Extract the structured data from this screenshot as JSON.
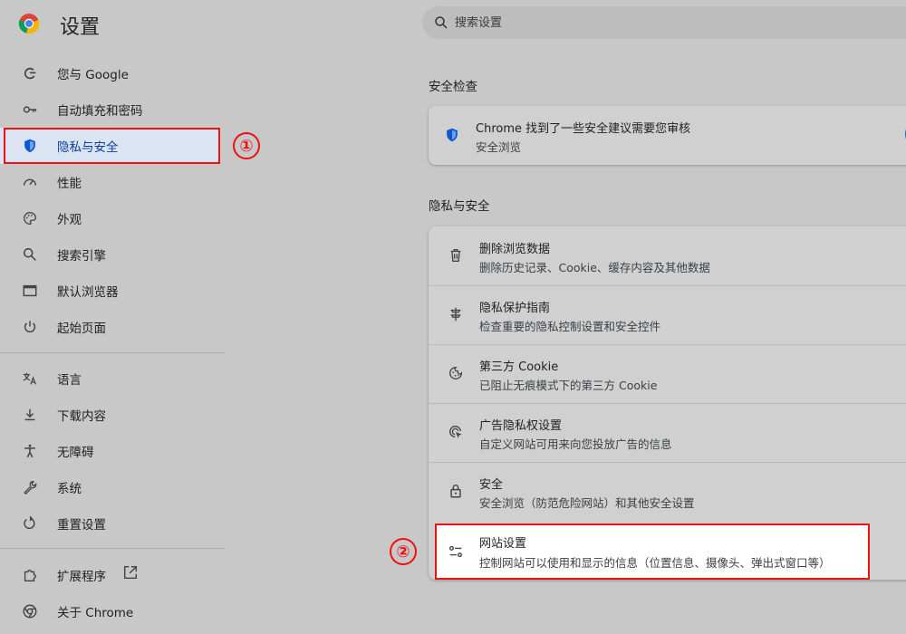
{
  "header": {
    "title": "设置",
    "search_placeholder": "搜索设置"
  },
  "sidebar": {
    "items": [
      {
        "label": "您与 Google",
        "icon": "google-g-icon"
      },
      {
        "label": "自动填充和密码",
        "icon": "key-icon"
      },
      {
        "label": "隐私与安全",
        "icon": "shield-icon",
        "active": true
      },
      {
        "label": "性能",
        "icon": "speedometer-icon"
      },
      {
        "label": "外观",
        "icon": "palette-icon"
      },
      {
        "label": "搜索引擎",
        "icon": "search-icon"
      },
      {
        "label": "默认浏览器",
        "icon": "browser-window-icon"
      },
      {
        "label": "起始页面",
        "icon": "power-icon"
      },
      {
        "label": "语言",
        "icon": "translate-icon"
      },
      {
        "label": "下载内容",
        "icon": "download-icon"
      },
      {
        "label": "无障碍",
        "icon": "accessibility-icon"
      },
      {
        "label": "系统",
        "icon": "wrench-icon"
      },
      {
        "label": "重置设置",
        "icon": "reset-icon"
      },
      {
        "label": "扩展程序",
        "icon": "puzzle-icon"
      },
      {
        "label": "关于 Chrome",
        "icon": "chrome-icon"
      }
    ]
  },
  "safety_check": {
    "section_title": "安全检查",
    "title": "Chrome 找到了一些安全建议需要您审核",
    "subtitle": "安全浏览"
  },
  "privacy": {
    "section_title": "隐私与安全",
    "rows": [
      {
        "title": "删除浏览数据",
        "subtitle": "删除历史记录、Cookie、缓存内容及其他数据",
        "icon": "trash-icon"
      },
      {
        "title": "隐私保护指南",
        "subtitle": "检查重要的隐私控制设置和安全控件",
        "icon": "privacy-guide-icon"
      },
      {
        "title": "第三方 Cookie",
        "subtitle": "已阻止无痕模式下的第三方 Cookie",
        "icon": "cookie-icon"
      },
      {
        "title": "广告隐私权设置",
        "subtitle": "自定义网站可用来向您投放广告的信息",
        "icon": "ad-privacy-icon"
      },
      {
        "title": "安全",
        "subtitle": "安全浏览（防范危险网站）和其他安全设置",
        "icon": "lock-icon"
      },
      {
        "title": "网站设置",
        "subtitle": "控制网站可以使用和显示的信息（位置信息、摄像头、弹出式窗口等）",
        "icon": "sliders-icon"
      }
    ]
  },
  "annotations": {
    "marker1": "①",
    "marker2": "②"
  },
  "colors": {
    "accent": "#0b57d0",
    "highlight": "#ee1111",
    "active_bg": "#dbe4f3"
  }
}
